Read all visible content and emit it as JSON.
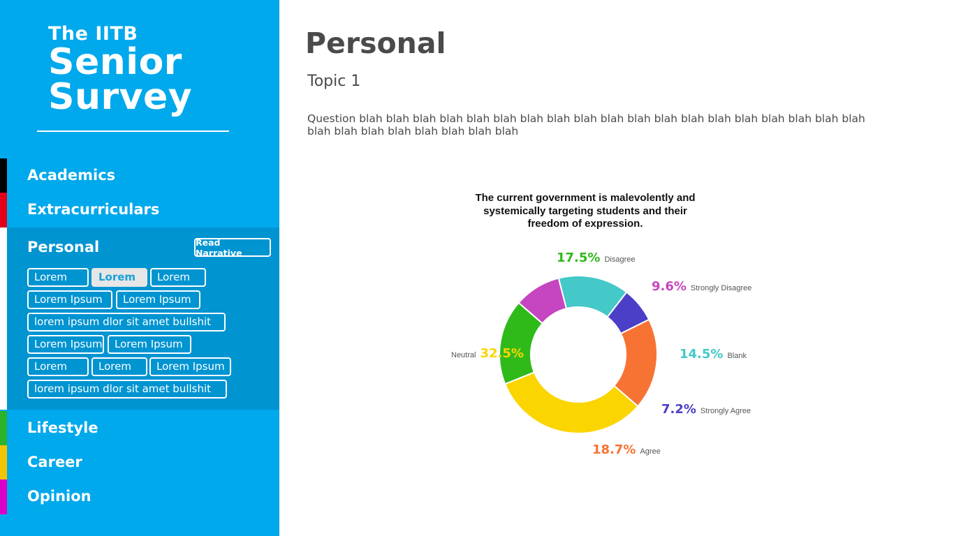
{
  "sidebar": {
    "logo": {
      "line1": "The IITB",
      "line2": "Senior",
      "line3": "Survey"
    },
    "nav": [
      {
        "label": "Academics",
        "color": "#000000"
      },
      {
        "label": "Extracurriculars",
        "color": "#e3001b"
      },
      {
        "label": "Personal",
        "color": "#ffffff"
      },
      {
        "label": "Lifestyle",
        "color": "#2bb32b"
      },
      {
        "label": "Career",
        "color": "#f5c400"
      },
      {
        "label": "Opinion",
        "color": "#d900c8"
      }
    ],
    "read_narrative": "Read Narrative",
    "subtopics": [
      "Lorem",
      "Lorem",
      "Lorem",
      "Lorem Ipsum",
      "Lorem Ipsum",
      "lorem ipsum dlor sit amet bullshit",
      "Lorem Ipsum",
      "Lorem Ipsum",
      "Lorem",
      "Lorem",
      "Lorem Ipsum",
      "lorem ipsum dlor sit amet bullshit"
    ],
    "active_subtopic_index": 1
  },
  "main": {
    "title": "Personal",
    "topic": "Topic 1",
    "question": "Question blah blah blah blah blah blah blah blah blah blah blah blah blah blah blah blah blah blah blah blah blah blah blah blah blah blah blah"
  },
  "chart_data": {
    "type": "pie",
    "subtype": "donut",
    "title": "The current government is malevolently and systemically targeting students and their freedom of expression.",
    "slices": [
      {
        "label": "Disagree",
        "pct_text": "17.5%",
        "value": 17.5,
        "color": "#2fba1a"
      },
      {
        "label": "Strongly Disagree",
        "pct_text": "9.6%",
        "value": 9.6,
        "color": "#c645c0"
      },
      {
        "label": "Blank",
        "pct_text": "14.5%",
        "value": 14.5,
        "color": "#44c8c8"
      },
      {
        "label": "Strongly Agree",
        "pct_text": "7.2%",
        "value": 7.2,
        "color": "#4b3fc8"
      },
      {
        "label": "Agree",
        "pct_text": "18.7%",
        "value": 18.7,
        "color": "#f77334"
      },
      {
        "label": "Neutral",
        "pct_text": "32.5%",
        "value": 32.5,
        "color": "#fbd500"
      }
    ]
  }
}
